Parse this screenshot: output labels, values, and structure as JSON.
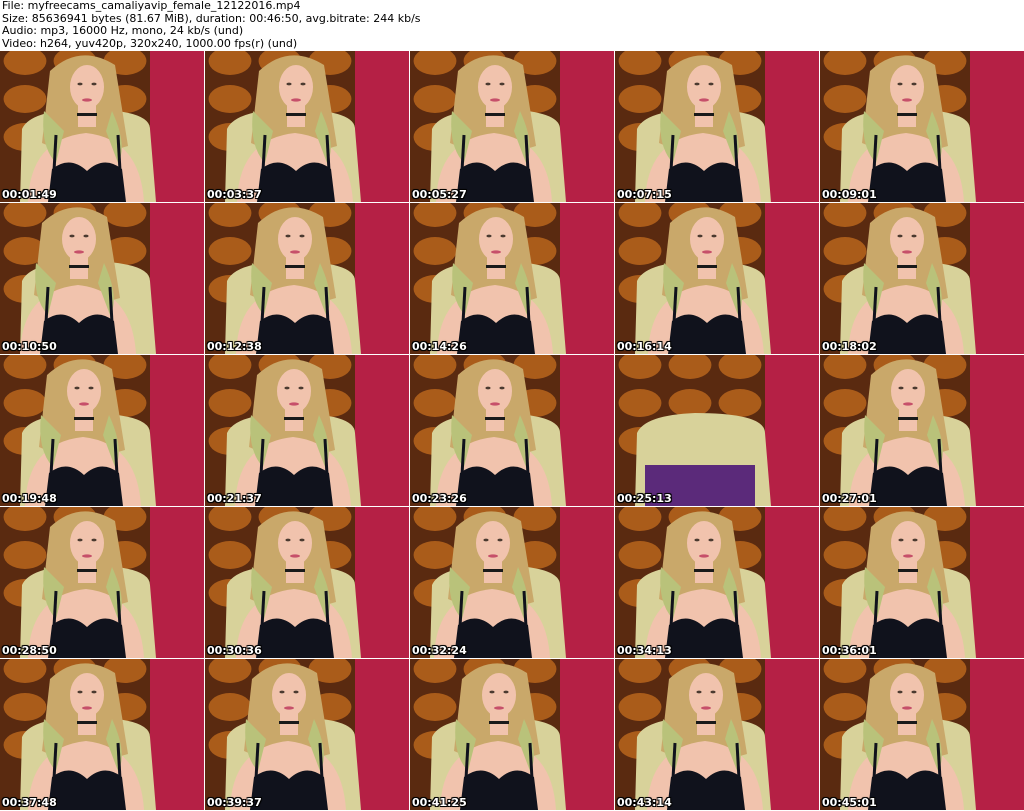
{
  "header": {
    "file_line": "File: myfreecams_camaliyavip_female_12122016.mp4",
    "size_line": "Size: 85636941 bytes (81.67 MiB), duration: 00:46:50, avg.bitrate: 244 kb/s",
    "audio_line": "Audio: mp3, 16000 Hz, mono, 24 kb/s (und)",
    "video_line": "Video: h264, yuv420p, 320x240, 1000.00 fps(r) (und)"
  },
  "colors": {
    "wall": "#b52045",
    "curtain_dark": "#5a2a10",
    "curtain_light": "#b8651c",
    "chair": "#d8d29a",
    "hair": "#c9a86a",
    "hair_tip": "#b9c27a",
    "skin": "#f1c3ad",
    "top": "#10121c"
  },
  "thumbnails": [
    {
      "timestamp": "00:01:49",
      "scene": "person"
    },
    {
      "timestamp": "00:03:37",
      "scene": "person"
    },
    {
      "timestamp": "00:05:27",
      "scene": "person"
    },
    {
      "timestamp": "00:07:15",
      "scene": "person"
    },
    {
      "timestamp": "00:09:01",
      "scene": "person"
    },
    {
      "timestamp": "00:10:50",
      "scene": "person"
    },
    {
      "timestamp": "00:12:38",
      "scene": "person"
    },
    {
      "timestamp": "00:14:26",
      "scene": "person"
    },
    {
      "timestamp": "00:16:14",
      "scene": "person"
    },
    {
      "timestamp": "00:18:02",
      "scene": "person"
    },
    {
      "timestamp": "00:19:48",
      "scene": "person"
    },
    {
      "timestamp": "00:21:37",
      "scene": "person"
    },
    {
      "timestamp": "00:23:26",
      "scene": "person"
    },
    {
      "timestamp": "00:25:13",
      "scene": "empty-chair"
    },
    {
      "timestamp": "00:27:01",
      "scene": "person"
    },
    {
      "timestamp": "00:28:50",
      "scene": "person"
    },
    {
      "timestamp": "00:30:36",
      "scene": "person"
    },
    {
      "timestamp": "00:32:24",
      "scene": "person"
    },
    {
      "timestamp": "00:34:13",
      "scene": "person"
    },
    {
      "timestamp": "00:36:01",
      "scene": "person"
    },
    {
      "timestamp": "00:37:48",
      "scene": "person"
    },
    {
      "timestamp": "00:39:37",
      "scene": "person"
    },
    {
      "timestamp": "00:41:25",
      "scene": "person"
    },
    {
      "timestamp": "00:43:14",
      "scene": "person"
    },
    {
      "timestamp": "00:45:01",
      "scene": "person"
    }
  ]
}
